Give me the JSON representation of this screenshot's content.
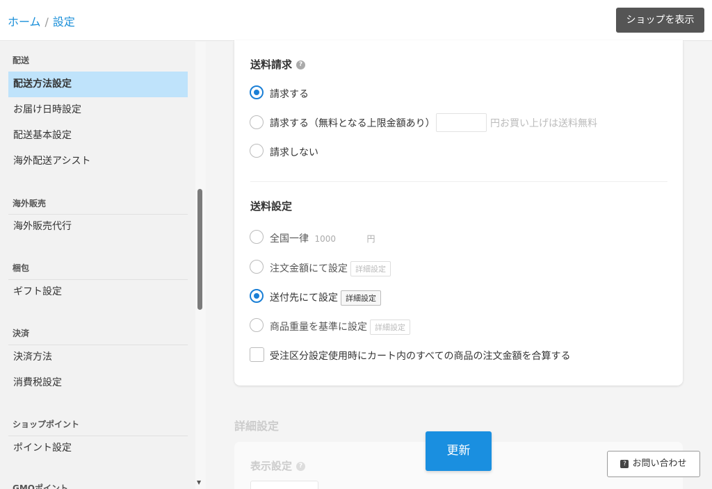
{
  "header": {
    "breadcrumb_home": "ホーム",
    "breadcrumb_sep": "/",
    "breadcrumb_current": "設定",
    "shop_button": "ショップを表示"
  },
  "sidebar": {
    "groups": [
      {
        "heading": "配送",
        "items": [
          "配送方法設定",
          "お届け日時設定",
          "配送基本設定",
          "海外配送アシスト"
        ]
      },
      {
        "heading": "海外販売",
        "items": [
          "海外販売代行"
        ]
      },
      {
        "heading": "梱包",
        "items": [
          "ギフト設定"
        ]
      },
      {
        "heading": "決済",
        "items": [
          "決済方法",
          "消費税設定"
        ]
      },
      {
        "heading": "ショップポイント",
        "items": [
          "ポイント設定"
        ]
      },
      {
        "heading": "GMOポイント",
        "items": []
      }
    ],
    "active": "配送方法設定"
  },
  "billing": {
    "title": "送料請求",
    "opt1": "請求する",
    "opt2": "請求する（無料となる上限金額あり）",
    "opt2_suffix": "円お買い上げは送料無料",
    "opt3": "請求しない",
    "selected": "請求する"
  },
  "shipping": {
    "title": "送料設定",
    "opt1": "全国一律",
    "opt1_value": "1000",
    "opt1_unit": "円",
    "opt2": "注文金額にて設定",
    "opt3": "送付先にて設定",
    "opt4": "商品重量を基準に設定",
    "detail_label": "詳細設定",
    "selected": "送付先にて設定",
    "checkbox_label": "受注区分設定使用時にカート内のすべての商品の注文金額を合算する"
  },
  "detail_section": {
    "title": "詳細設定",
    "display_title": "表示設定"
  },
  "update_button": "更新",
  "contact_button": "お問い合わせ",
  "colors": {
    "accent": "#1a8fe0",
    "active_item": "#bfe3fb"
  }
}
